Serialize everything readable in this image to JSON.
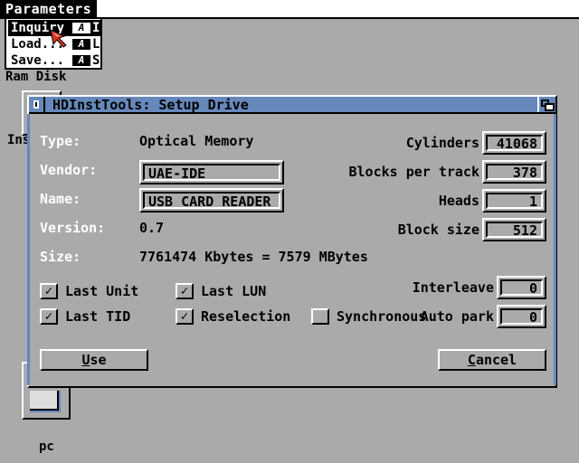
{
  "screen": {
    "menu_title": "Parameters",
    "menu_items": [
      {
        "label": "Inquiry",
        "modifier": "A",
        "shortcut": "I",
        "selected": true
      },
      {
        "label": "Load...",
        "modifier": "A",
        "shortcut": "L",
        "selected": false
      },
      {
        "label": "Save...",
        "modifier": "A",
        "shortcut": "S",
        "selected": false
      }
    ]
  },
  "desktop": {
    "icons": [
      {
        "label": "Ram Disk"
      },
      {
        "label": "Ins"
      },
      {
        "label": "pc"
      }
    ]
  },
  "window": {
    "title": "HDInstTools: Setup Drive",
    "close_icon": "close-icon",
    "depth_icon": "depth-arrange-icon",
    "fields": {
      "type_label": "Type:",
      "type_value": "Optical Memory",
      "vendor_label": "Vendor:",
      "vendor_value": "UAE-IDE",
      "name_label": "Name:",
      "name_value": "USB CARD READER",
      "version_label": "Version:",
      "version_value": "0.7",
      "size_label": "Size:",
      "size_value": "7761474 Kbytes = 7579 MBytes"
    },
    "geometry": {
      "cylinders_label": "Cylinders",
      "cylinders_value": "41068",
      "blocks_per_track_label": "Blocks per track",
      "blocks_per_track_value": "378",
      "heads_label": "Heads",
      "heads_value": "1",
      "block_size_label": "Block size",
      "block_size_value": "512",
      "interleave_label": "Interleave",
      "interleave_value": "0",
      "auto_park_label": "Auto park",
      "auto_park_value": "0"
    },
    "checkboxes": [
      {
        "label": "Last Unit",
        "checked": true
      },
      {
        "label": "Last LUN",
        "checked": true
      },
      {
        "label": "Last TID",
        "checked": true
      },
      {
        "label": "Reselection",
        "checked": true
      },
      {
        "label": "Synchronous",
        "checked": false
      }
    ],
    "buttons": {
      "use_hotkey": "U",
      "use_rest": "se",
      "cancel_hotkey": "C",
      "cancel_rest": "ancel"
    },
    "colors": {
      "background": "#aaaaaa",
      "titlebar": "#6688bb",
      "text": "#000000",
      "label_light": "#ffffff"
    }
  }
}
